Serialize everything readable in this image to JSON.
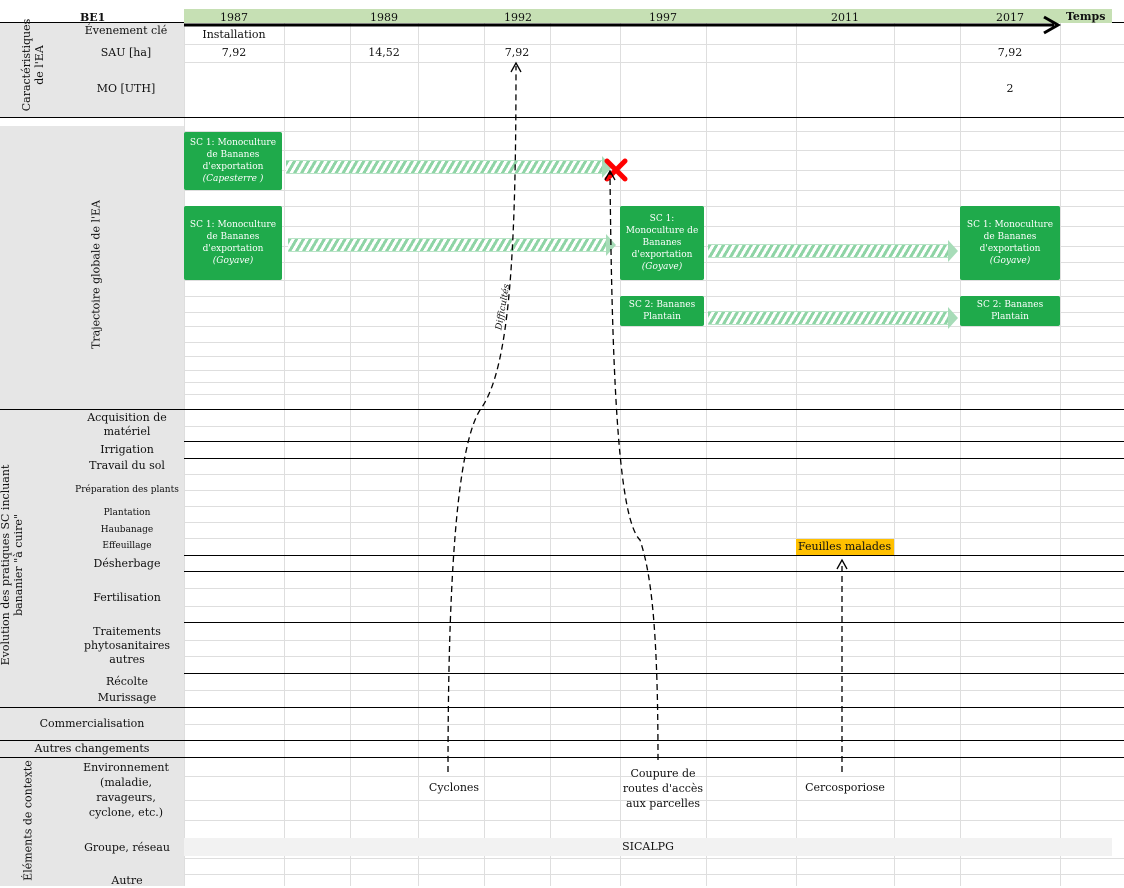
{
  "header": {
    "corner": "BE1",
    "years": [
      "1987",
      "1989",
      "1992",
      "1997",
      "2011",
      "2017"
    ],
    "time_label": "Temps"
  },
  "characteristics": {
    "section_label": "Caractéristiques de l'EA",
    "rows": {
      "event_label": "Évenement clé",
      "event_value": "Installation",
      "sau_label": "SAU [ha]",
      "sau_values": [
        "7,92",
        "14,52",
        "7,92",
        "7,92"
      ],
      "mo_label": "MO [UTH]",
      "mo_value": "2"
    }
  },
  "trajectory": {
    "section_label": "Trajectoire globale de l'EA",
    "boxes": {
      "sc1_capesterre": {
        "line1": "SC 1: Monoculture de Bananes d'exportation",
        "place": "(Capesterre )"
      },
      "sc1_goyave_a": {
        "line1": "SC 1: Monoculture de Bananes d'exportation",
        "place": "(Goyave)"
      },
      "sc1_goyave_b": {
        "line1": "SC 1: Monoculture de Bananes d'exportation",
        "place": "(Goyave)"
      },
      "sc1_goyave_c": {
        "line1": "SC 1: Monoculture de Bananes d'exportation",
        "place": "(Goyave)"
      },
      "sc2_a": {
        "line1": "SC 2: Bananes Plantain"
      },
      "sc2_b": {
        "line1": "SC 2: Bananes Plantain"
      }
    },
    "difficulty_label": "Difficultés"
  },
  "practices": {
    "section_label": "Évolution des pratiques SC incluant bananier \"à cuire\"",
    "rows": [
      "Acquisition de matériel",
      "Irrigation",
      "Travail du sol",
      "Préparation des plants",
      "Plantation",
      "Haubanage",
      "Effeuillage",
      "Désherbage",
      "Fertilisation",
      "Traitements phytosanitaires autres",
      "Récolte",
      "Murissage"
    ],
    "diseased_leaves": "Feuilles malades"
  },
  "commercialisation": "Commercialisation",
  "other_changes": "Autres changements",
  "context": {
    "section_label": "Éléments de contexte",
    "environment_label": "Environnement (maladie, ravageurs, cyclone, etc.)",
    "group_label": "Groupe, réseau",
    "other_label": "Autre",
    "events": [
      "Cyclones",
      "Coupure de routes d'accès aux parcelles",
      "Cercosporiose"
    ],
    "group_value": "SICALPG"
  },
  "colors": {
    "green_box": "#1faa4b",
    "year_band": "#c6e0b4",
    "highlight": "#ffc000",
    "cross": "#ff0000"
  }
}
